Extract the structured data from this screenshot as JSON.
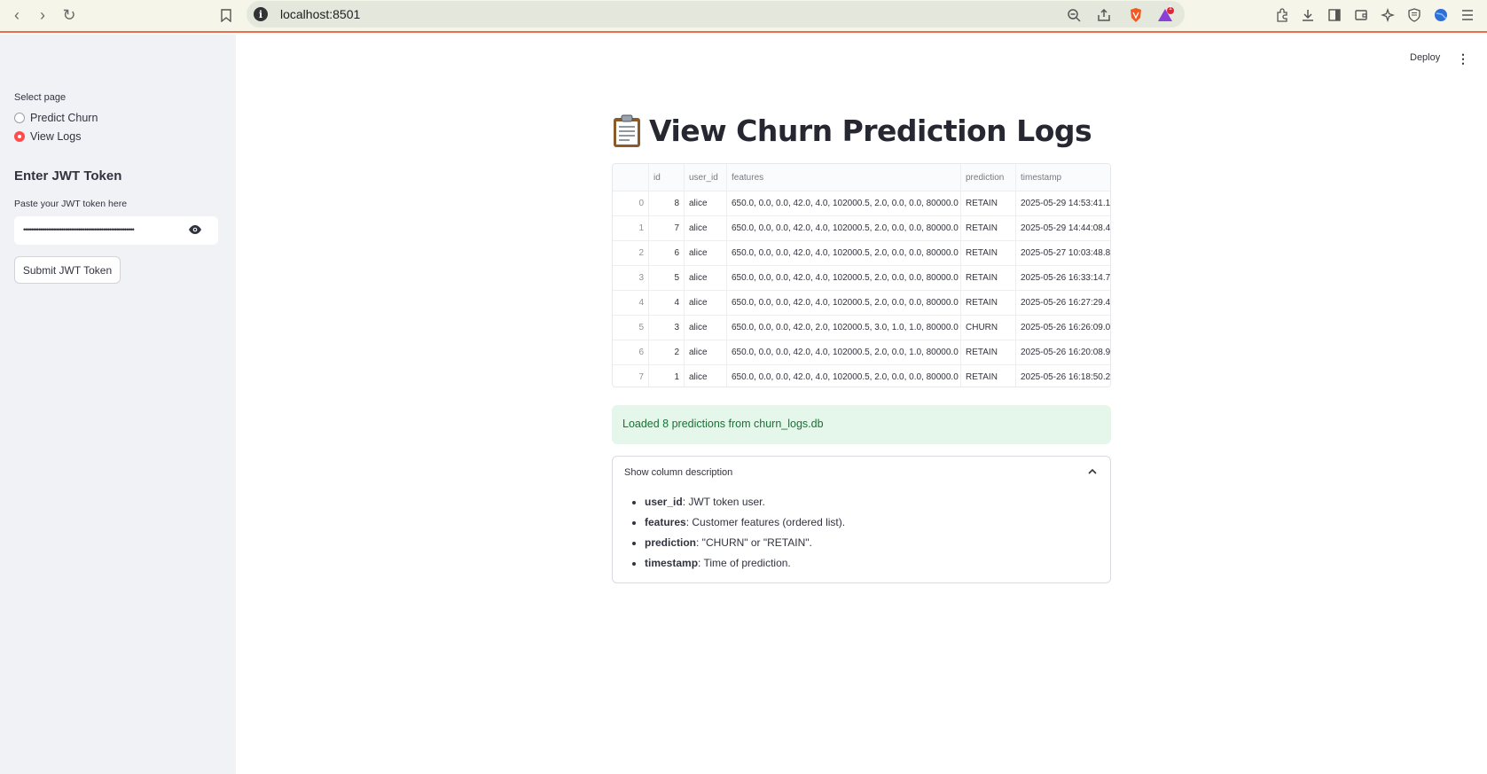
{
  "browser": {
    "url": "localhost:8501",
    "notification_count": "1"
  },
  "sidebar": {
    "select_label": "Select page",
    "pages": [
      "Predict Churn",
      "View Logs"
    ],
    "selected_page": "View Logs",
    "jwt_heading": "Enter JWT Token",
    "jwt_label": "Paste your JWT token here",
    "jwt_masked_value": "••••••••••••••••••••••••••••••••••••••••••••••••••••••••••",
    "submit_label": "Submit JWT Token"
  },
  "header": {
    "deploy_label": "Deploy"
  },
  "main": {
    "title": "View Churn Prediction Logs",
    "table": {
      "columns": [
        "",
        "id",
        "user_id",
        "features",
        "prediction",
        "timestamp"
      ],
      "rows": [
        [
          "0",
          "8",
          "alice",
          "650.0, 0.0, 0.0, 42.0, 4.0, 102000.5, 2.0, 0.0, 0.0, 80000.0",
          "RETAIN",
          "2025-05-29 14:53:41.1"
        ],
        [
          "1",
          "7",
          "alice",
          "650.0, 0.0, 0.0, 42.0, 4.0, 102000.5, 2.0, 0.0, 0.0, 80000.0",
          "RETAIN",
          "2025-05-29 14:44:08.4"
        ],
        [
          "2",
          "6",
          "alice",
          "650.0, 0.0, 0.0, 42.0, 4.0, 102000.5, 2.0, 0.0, 0.0, 80000.0",
          "RETAIN",
          "2025-05-27 10:03:48.8"
        ],
        [
          "3",
          "5",
          "alice",
          "650.0, 0.0, 0.0, 42.0, 4.0, 102000.5, 2.0, 0.0, 0.0, 80000.0",
          "RETAIN",
          "2025-05-26 16:33:14.7"
        ],
        [
          "4",
          "4",
          "alice",
          "650.0, 0.0, 0.0, 42.0, 4.0, 102000.5, 2.0, 0.0, 0.0, 80000.0",
          "RETAIN",
          "2025-05-26 16:27:29.4"
        ],
        [
          "5",
          "3",
          "alice",
          "650.0, 0.0, 0.0, 42.0, 2.0, 102000.5, 3.0, 1.0, 1.0, 80000.0",
          "CHURN",
          "2025-05-26 16:26:09.0"
        ],
        [
          "6",
          "2",
          "alice",
          "650.0, 0.0, 0.0, 42.0, 4.0, 102000.5, 2.0, 0.0, 1.0, 80000.0",
          "RETAIN",
          "2025-05-26 16:20:08.9"
        ],
        [
          "7",
          "1",
          "alice",
          "650.0, 0.0, 0.0, 42.0, 4.0, 102000.5, 2.0, 0.0, 0.0, 80000.0",
          "RETAIN",
          "2025-05-26 16:18:50.2"
        ]
      ]
    },
    "success_message": "Loaded 8 predictions from churn_logs.db",
    "expander": {
      "title": "Show column description",
      "items": [
        {
          "term": "user_id",
          "desc": ": JWT token user."
        },
        {
          "term": "features",
          "desc": ": Customer features (ordered list)."
        },
        {
          "term": "prediction",
          "desc": ": \"CHURN\" or \"RETAIN\"."
        },
        {
          "term": "timestamp",
          "desc": ": Time of prediction."
        }
      ]
    }
  },
  "icons": {
    "title_emoji": "clipboard-icon",
    "password_toggle": "eye-icon",
    "expander_toggle": "chevron-up-icon"
  },
  "colors": {
    "accent": "#ff4b4b",
    "sidebar_bg": "#f0f2f6",
    "success_bg": "#e4f7ea",
    "success_text": "#177233"
  }
}
